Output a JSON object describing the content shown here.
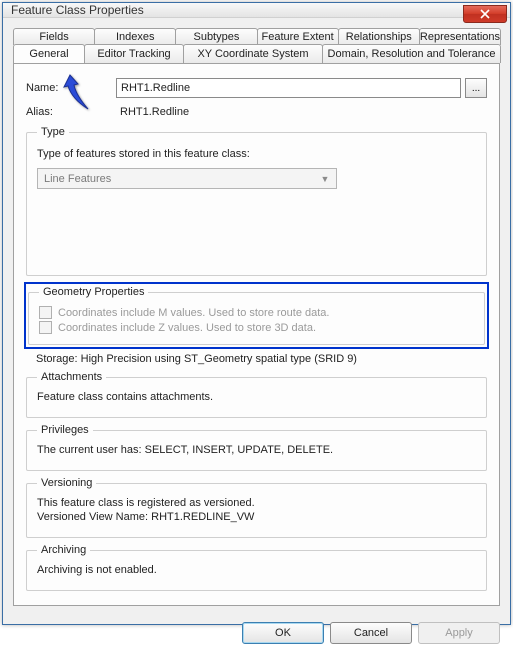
{
  "window": {
    "title": "Feature Class Properties"
  },
  "tabs": {
    "row1": [
      "Fields",
      "Indexes",
      "Subtypes",
      "Feature Extent",
      "Relationships",
      "Representations"
    ],
    "row2": [
      "General",
      "Editor Tracking",
      "XY Coordinate System",
      "Domain, Resolution and Tolerance"
    ]
  },
  "general": {
    "name_label": "Name:",
    "name_value": "RHT1.Redline",
    "alias_label": "Alias:",
    "alias_value": "RHT1.Redline",
    "browse_label": "..."
  },
  "type": {
    "legend": "Type",
    "caption": "Type of features stored in this feature class:",
    "combo_value": "Line Features"
  },
  "geometry": {
    "legend": "Geometry Properties",
    "m_label": "Coordinates include M values. Used to store route data.",
    "z_label": "Coordinates include Z values. Used to store 3D data."
  },
  "storage_line": "Storage: High Precision using ST_Geometry spatial type (SRID 9)",
  "attachments": {
    "legend": "Attachments",
    "line": "Feature class contains attachments."
  },
  "privileges": {
    "legend": "Privileges",
    "line": "The current user has: SELECT, INSERT, UPDATE, DELETE."
  },
  "versioning": {
    "legend": "Versioning",
    "line1": "This feature class is registered as versioned.",
    "line2": "Versioned View Name: RHT1.REDLINE_VW"
  },
  "archiving": {
    "legend": "Archiving",
    "line": "Archiving is not enabled."
  },
  "buttons": {
    "ok": "OK",
    "cancel": "Cancel",
    "apply": "Apply"
  }
}
